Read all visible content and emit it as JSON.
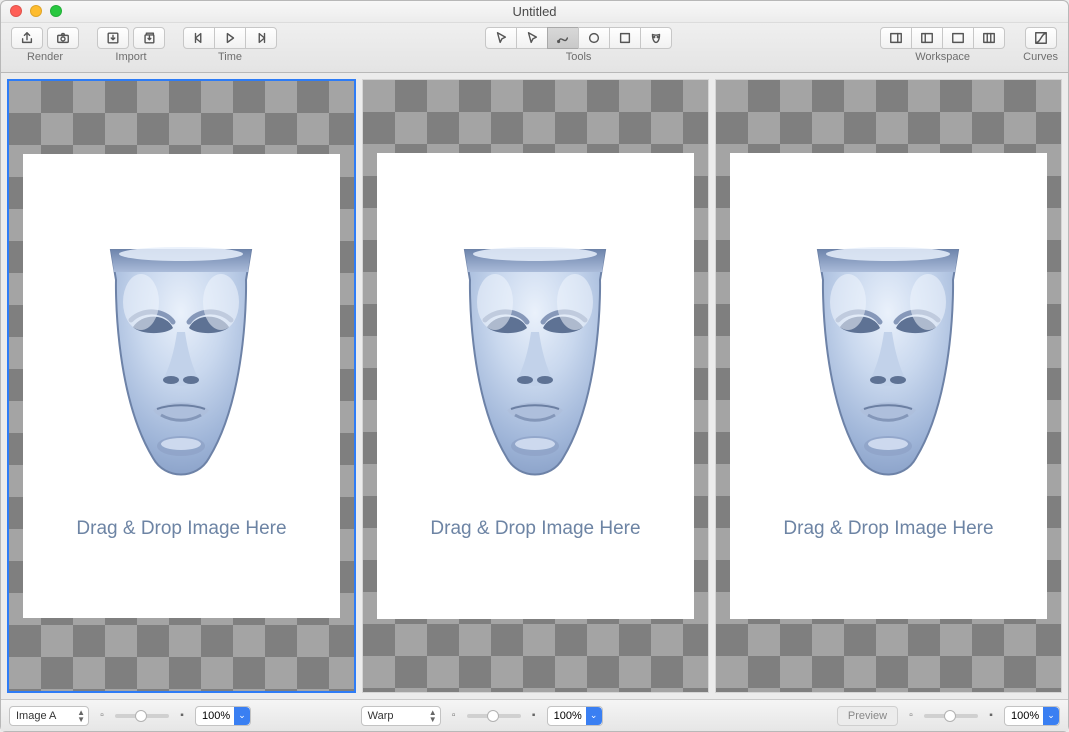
{
  "window": {
    "title": "Untitled"
  },
  "toolbar": {
    "groups": {
      "render": {
        "label": "Render"
      },
      "import": {
        "label": "Import"
      },
      "time": {
        "label": "Time"
      },
      "tools": {
        "label": "Tools"
      },
      "workspace": {
        "label": "Workspace"
      },
      "curves": {
        "label": "Curves"
      }
    }
  },
  "panes": [
    {
      "id": "a",
      "selected": true,
      "placeholder": "Drag & Drop Image Here"
    },
    {
      "id": "b",
      "selected": false,
      "placeholder": "Drag & Drop Image Here"
    },
    {
      "id": "c",
      "selected": false,
      "placeholder": "Drag & Drop Image Here"
    }
  ],
  "footer": {
    "left": {
      "selector": "Image A",
      "zoom": "100%"
    },
    "center": {
      "selector": "Warp",
      "zoom": "100%"
    },
    "right": {
      "preview_label": "Preview",
      "zoom": "100%"
    }
  }
}
